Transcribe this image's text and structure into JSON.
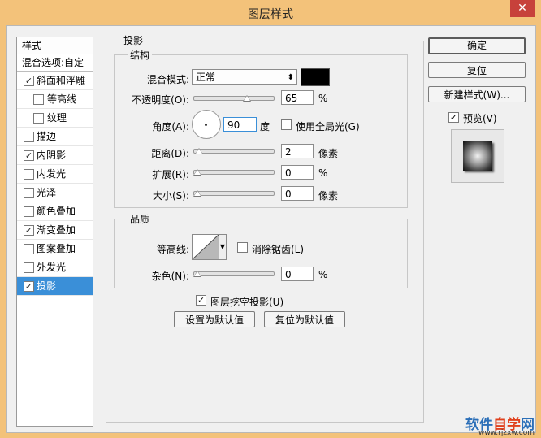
{
  "window": {
    "title": "图层样式",
    "close": "✕"
  },
  "styles_list": {
    "header": "样式",
    "blend_options": "混合选项:自定",
    "items": [
      {
        "label": "斜面和浮雕",
        "checked": true
      },
      {
        "label": "等高线",
        "checked": false
      },
      {
        "label": "纹理",
        "checked": false
      },
      {
        "label": "描边",
        "checked": false
      },
      {
        "label": "内阴影",
        "checked": true
      },
      {
        "label": "内发光",
        "checked": false
      },
      {
        "label": "光泽",
        "checked": false
      },
      {
        "label": "颜色叠加",
        "checked": false
      },
      {
        "label": "渐变叠加",
        "checked": true
      },
      {
        "label": "图案叠加",
        "checked": false
      },
      {
        "label": "外发光",
        "checked": false
      },
      {
        "label": "投影",
        "checked": true
      }
    ]
  },
  "drop_shadow": {
    "section_title": "投影",
    "structure": {
      "title": "结构",
      "blend_mode_label": "混合模式:",
      "blend_mode_value": "正常",
      "color": "#000000",
      "opacity_label": "不透明度(O):",
      "opacity_value": "65",
      "opacity_unit": "%",
      "opacity_level": 0.65,
      "angle_label": "角度(A):",
      "angle_value": "90",
      "angle_unit": "度",
      "global_light_label": "使用全局光(G)",
      "global_light_checked": false,
      "distance_label": "距离(D):",
      "distance_value": "2",
      "distance_unit": "像素",
      "spread_label": "扩展(R):",
      "spread_value": "0",
      "spread_unit": "%",
      "size_label": "大小(S):",
      "size_value": "0",
      "size_unit": "像素"
    },
    "quality": {
      "title": "品质",
      "contour_label": "等高线:",
      "anti_alias_label": "消除锯齿(L)",
      "anti_alias_checked": false,
      "noise_label": "杂色(N):",
      "noise_value": "0",
      "noise_unit": "%"
    },
    "knockout_label": "图层挖空投影(U)",
    "knockout_checked": true,
    "make_default": "设置为默认值",
    "reset_default": "复位为默认值"
  },
  "buttons": {
    "ok": "确定",
    "reset": "复位",
    "new_style": "新建样式(W)...",
    "preview_label": "预览(V)",
    "preview_checked": true
  },
  "watermark": {
    "brand_a": "软件",
    "brand_b": "自学",
    "brand_c": "网",
    "domain": "www.rjzxw.com"
  }
}
